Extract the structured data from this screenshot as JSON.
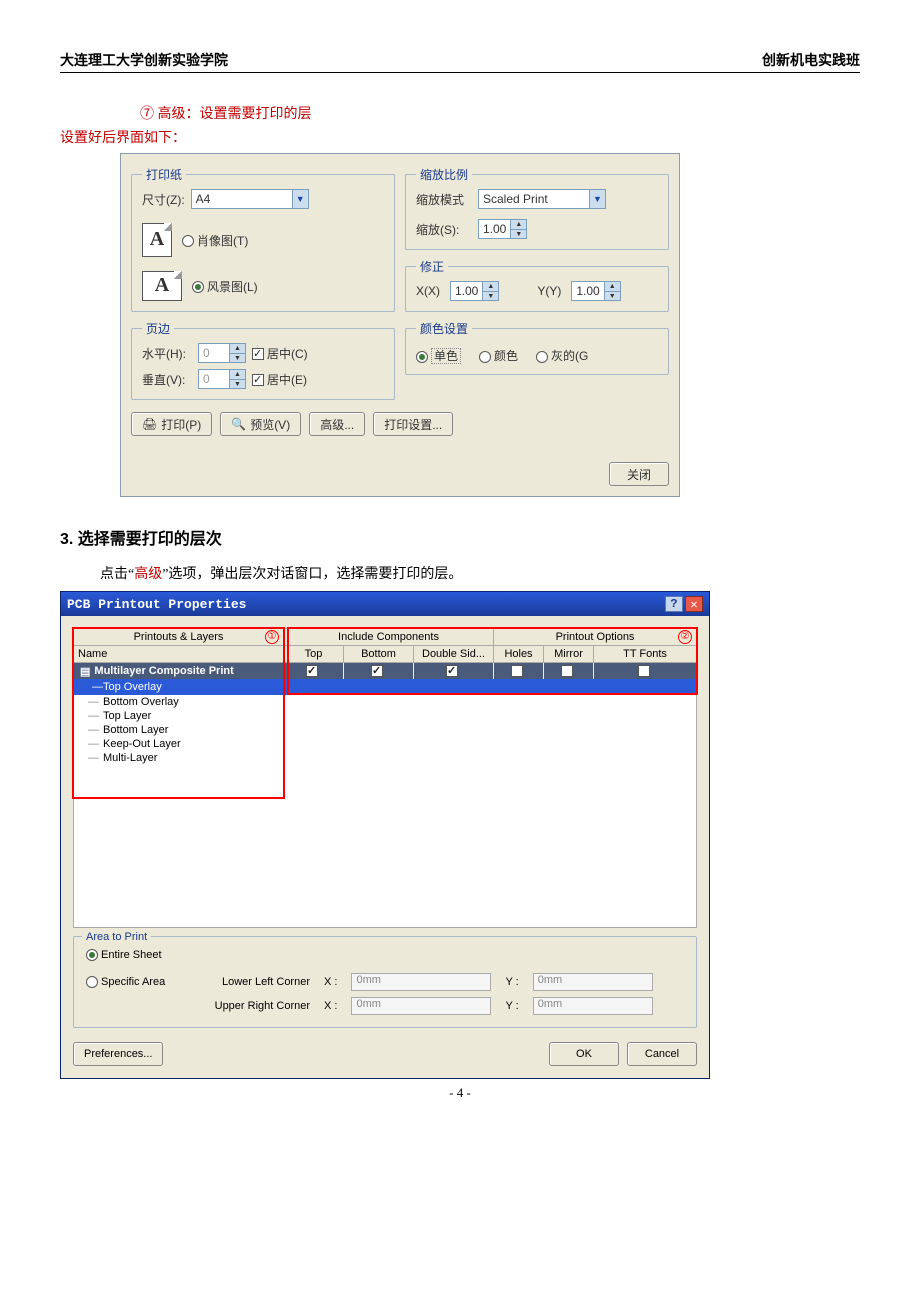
{
  "header": {
    "left": "大连理工大学创新实验学院",
    "right": "创新机电实践班"
  },
  "step7": {
    "num": "⑦",
    "text": "高级：设置需要打印的层"
  },
  "caption_after": "设置好后界面如下：",
  "dlg1": {
    "paper": {
      "legend": "打印纸",
      "size_label": "尺寸(Z):",
      "size_value": "A4",
      "portrait_label": "肖像图(T)",
      "landscape_label": "风景图(L)"
    },
    "scale": {
      "legend": "缩放比例",
      "mode_label": "缩放模式",
      "mode_value": "Scaled Print",
      "scale_label": "缩放(S):",
      "scale_value": "1.00"
    },
    "corr": {
      "legend": "修正",
      "x_label": "X(X)",
      "x_value": "1.00",
      "y_label": "Y(Y)",
      "y_value": "1.00"
    },
    "margin": {
      "legend": "页边",
      "h_label": "水平(H):",
      "h_value": "0",
      "v_label": "垂直(V):",
      "v_value": "0",
      "centerH": "居中(C)",
      "centerV": "居中(E)"
    },
    "color": {
      "legend": "颜色设置",
      "mono": "单色",
      "color": "颜色",
      "gray": "灰的(G"
    },
    "buttons": {
      "print": "打印(P)",
      "preview": "预览(V)",
      "advanced": "高级...",
      "setup": "打印设置...",
      "close": "关闭"
    }
  },
  "section3": {
    "title": "3.  选择需要打印的层次",
    "para_before": "点击“",
    "para_red": "高级",
    "para_after": "”选项，弹出层次对话窗口，选择需要打印的层。"
  },
  "dlg2": {
    "title": "PCB Printout Properties",
    "hdr_sec1": "Printouts & Layers",
    "hdr_sec2": "Include Components",
    "hdr_sec3": "Printout Options",
    "col_name": "Name",
    "col_top": "Top",
    "col_bottom": "Bottom",
    "col_ds": "Double Sid...",
    "col_holes": "Holes",
    "col_mirror": "Mirror",
    "col_tt": "TT Fonts",
    "root": "Multilayer Composite Print",
    "layers": [
      "Top Overlay",
      "Bottom Overlay",
      "Top Layer",
      "Bottom Layer",
      "Keep-Out Layer",
      "Multi-Layer"
    ],
    "area": {
      "legend": "Area to Print",
      "entire": "Entire Sheet",
      "specific": "Specific Area",
      "llc": "Lower Left Corner",
      "urc": "Upper Right Corner",
      "x": "X :",
      "y": "Y :",
      "val": "0mm"
    },
    "buttons": {
      "pref": "Preferences...",
      "ok": "OK",
      "cancel": "Cancel"
    }
  },
  "page_num": "- 4 -"
}
